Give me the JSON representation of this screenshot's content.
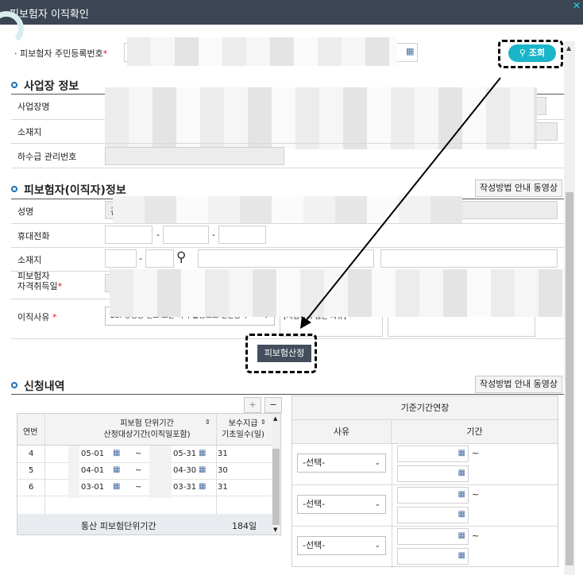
{
  "window": {
    "title": "피보험자 이직확인",
    "close_glyph": "✕"
  },
  "search": {
    "ssn_label": "피보험자 주민등록번호",
    "required_mark": "*",
    "search_button": "조회"
  },
  "workplace": {
    "section_title": "사업장 정보",
    "name_label": "사업장명",
    "address_label": "소재지",
    "subcontract_label": "하수급 관리번호"
  },
  "insured": {
    "section_title": "피보험자(이직자)정보",
    "guide_button": "작성방법 안내 동영상",
    "name_label": "성명",
    "name_value_partial": "김",
    "mobile_label": "휴대전화",
    "mobile_sep1": "-",
    "mobile_sep2": "-",
    "address_label": "소재지",
    "address_sep": "-",
    "acquire_label_line1": "피보험자",
    "acquire_label_line2": "자격취득일",
    "reason_label": "이직사유",
    "reason_select_partial": "23. 경영상 필요 또는 회사 불황으로 인원감축",
    "reason_code_partial": "[지정하지 않은 사유]"
  },
  "calc_button": "피보험산정",
  "apply": {
    "section_title": "신청내역",
    "guide_button": "작성방법 안내 동영상",
    "plus": "+",
    "minus": "−",
    "headers": {
      "seq": "연번",
      "period_line1": "피보험 단위기간",
      "period_line2": "산정대상기간(이직일포함)",
      "days_line1": "보수지급",
      "days_line2": "기초일수(일)"
    },
    "rows": [
      {
        "seq": "4",
        "from": "05-01",
        "to": "05-31",
        "days": "31"
      },
      {
        "seq": "5",
        "from": "04-01",
        "to": "04-30",
        "days": "30"
      },
      {
        "seq": "6",
        "from": "03-01",
        "to": "03-31",
        "days": "31"
      }
    ],
    "tilde": "~",
    "total_label": "통산 피보험단위기간",
    "total_value": "184일"
  },
  "extension": {
    "title": "기준기간연장",
    "reason_header": "사유",
    "period_header": "기간",
    "select_placeholder": "-선택-",
    "tilde": "~",
    "row_count": 3
  },
  "colors": {
    "accent": "#1ab5c8",
    "titlebar": "#3b4553",
    "section_dot": "#1c6fb8",
    "required": "#dd1122"
  }
}
